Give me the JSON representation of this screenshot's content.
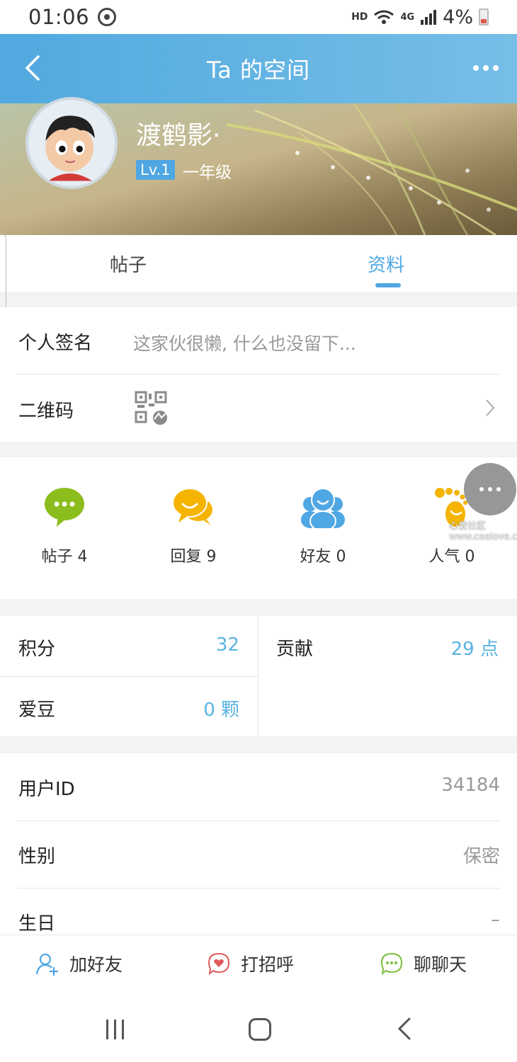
{
  "status_bar": {
    "time": "01:06",
    "hd": "HD",
    "network": "4G",
    "battery": "4%"
  },
  "header": {
    "title": "Ta 的空间",
    "username": "渡鹤影·",
    "level": "Lv.1",
    "grade": "一年级"
  },
  "tabs": [
    {
      "label": "帖子"
    },
    {
      "label": "资料"
    }
  ],
  "profile": {
    "signature_label": "个人签名",
    "signature_value": "这家伙很懒, 什么也没留下...",
    "qrcode_label": "二维码"
  },
  "stats": [
    {
      "label": "帖子 4",
      "icon": "chat-bubble-icon",
      "color": "#8bbd1c"
    },
    {
      "label": "回复 9",
      "icon": "reply-bubbles-icon",
      "color": "#f5b400"
    },
    {
      "label": "好友 0",
      "icon": "friends-icon",
      "color": "#4fa7e3"
    },
    {
      "label": "人气 0",
      "icon": "footprint-icon",
      "color": "#f5b400"
    }
  ],
  "watermark": {
    "line1": "心爱社区",
    "line2": "www.ceelove.com"
  },
  "points": {
    "jifen_label": "积分",
    "jifen_value": "32",
    "gongxian_label": "贡献",
    "gongxian_value": "29 点",
    "aidou_label": "爱豆",
    "aidou_value": "0 颗"
  },
  "info": {
    "user_id_label": "用户ID",
    "user_id_value": "34184",
    "gender_label": "性别",
    "gender_value": "保密",
    "birthday_label": "生日",
    "birthday_value": "–"
  },
  "actions": {
    "add_friend": "加好友",
    "greet": "打招呼",
    "chat": "聊聊天"
  },
  "colors": {
    "accent": "#4fa7e3",
    "value_blue": "#5ab3e2"
  }
}
